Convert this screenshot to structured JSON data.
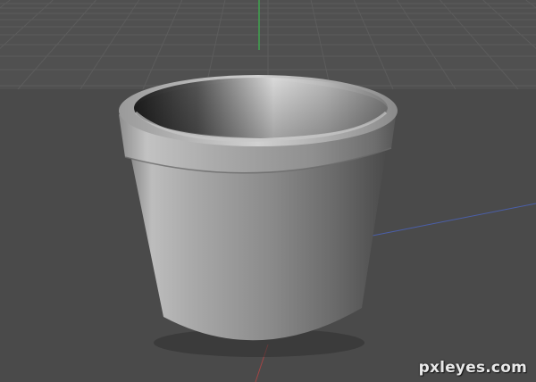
{
  "scene": {
    "object": "pot",
    "colors": {
      "background": "#4a4a4a",
      "grid_line": "#5c5c5c",
      "axis_green": "#3fa34d",
      "axis_red": "#a34545",
      "axis_blue": "#4b5fa8"
    }
  },
  "watermark": {
    "text": "pxleyes.com"
  }
}
